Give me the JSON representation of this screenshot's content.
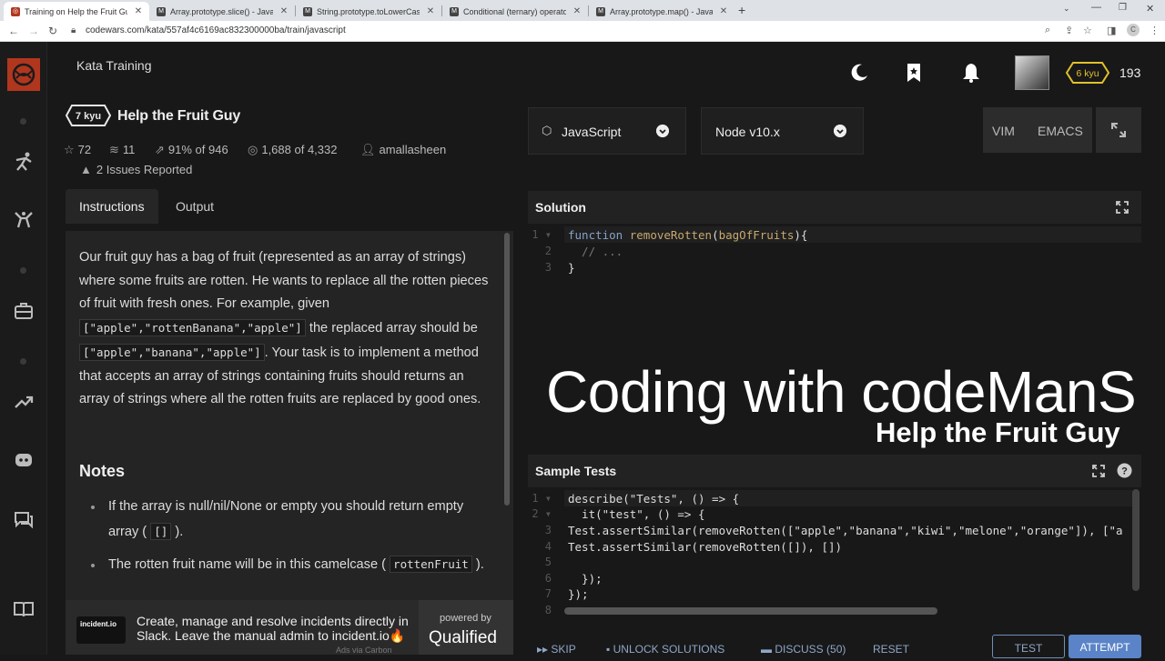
{
  "browser": {
    "tabs": [
      {
        "title": "Training on Help the Fruit Guy | C",
        "active": true
      },
      {
        "title": "Array.prototype.slice() - JavaScr",
        "active": false
      },
      {
        "title": "String.prototype.toLowerCase() -",
        "active": false
      },
      {
        "title": "Conditional (ternary) operator - J",
        "active": false
      },
      {
        "title": "Array.prototype.map() - JavaScri",
        "active": false
      }
    ],
    "url": "codewars.com/kata/557af4c6169ac832300000ba/train/javascript"
  },
  "header": {
    "kata_training": "Kata Training",
    "rank": "6 kyu",
    "honor": "193"
  },
  "kata": {
    "rank": "7 kyu",
    "title": "Help the Fruit Guy",
    "stars": "72",
    "collections": "11",
    "satisfaction": "91% of 946",
    "completed": "1,688 of 4,332",
    "author": "amallasheen",
    "issues": "2 Issues Reported"
  },
  "tabs": {
    "instructions": "Instructions",
    "output": "Output"
  },
  "instructions": {
    "p1": "Our fruit guy has a bag of fruit (represented as an array of strings) where some fruits are rotten. He wants to replace all the rotten pieces of fruit with fresh ones. For example, given",
    "code1": "[\"apple\",\"rottenBanana\",\"apple\"]",
    "p2": "the replaced array should be",
    "code2": "[\"apple\",\"banana\",\"apple\"]",
    "p3": ". Your task is to implement a method that accepts an array of strings containing fruits should returns an array of strings where all the rotten fruits are replaced by good ones.",
    "notes_heading": "Notes",
    "note1_a": "If the array is null/nil/None or empty you should return empty array (",
    "note1_code": "[]",
    "note1_b": ").",
    "note2_a": "The rotten fruit name will be in this camelcase (",
    "note2_code": "rottenFruit",
    "note2_b": ")."
  },
  "ad": {
    "logo": "incident.io",
    "text": "Create, manage and resolve incidents directly in Slack. Leave the manual admin to incident.io🔥",
    "powered": "powered by",
    "brand": "Qualified",
    "via": "Ads via Carbon"
  },
  "editor_controls": {
    "language": "JavaScript",
    "version": "Node v10.x",
    "vim": "VIM",
    "emacs": "EMACS"
  },
  "solution": {
    "title": "Solution",
    "lines": [
      "function removeRotten(bagOfFruits){",
      "  // ...",
      "}"
    ]
  },
  "overlay": {
    "line1": "Coding with codeManS",
    "line2": "Help the Fruit Guy"
  },
  "sample_tests": {
    "title": "Sample Tests",
    "lines": [
      "describe(\"Tests\", () => {",
      "  it(\"test\", () => {",
      "Test.assertSimilar(removeRotten([\"apple\",\"banana\",\"kiwi\",\"melone\",\"orange\"]), [\"a",
      "Test.assertSimilar(removeRotten([]), [])",
      "",
      "  });",
      "});",
      ""
    ]
  },
  "footer": {
    "skip": "SKIP",
    "unlock": "UNLOCK SOLUTIONS",
    "discuss": "DISCUSS (50)",
    "reset": "RESET",
    "test": "TEST",
    "attempt": "ATTEMPT"
  },
  "colors": {
    "accent": "#b1361e",
    "button": "#5a84c7",
    "background": "#181818"
  }
}
